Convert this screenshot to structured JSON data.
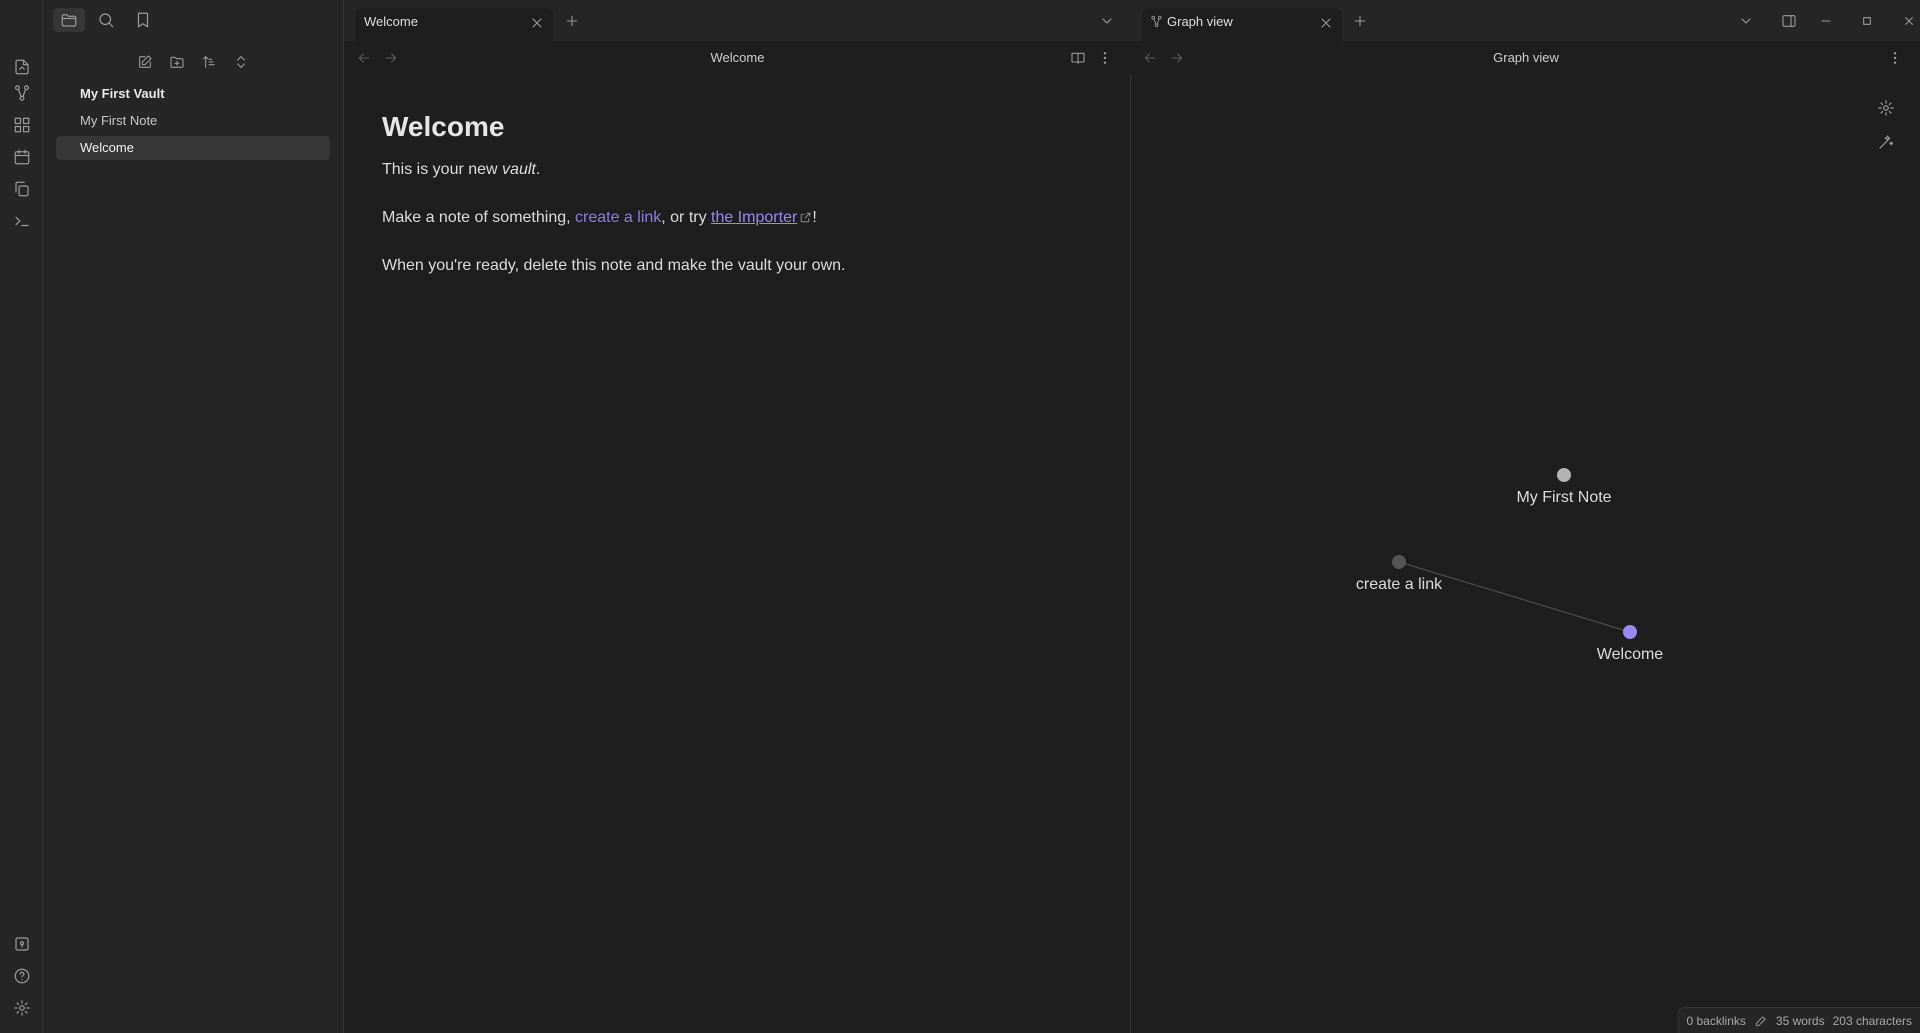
{
  "colors": {
    "accent": "#8f7be0",
    "node_active": "#9b87f5",
    "node_default": "#b3b3b3",
    "node_unresolved": "#555555",
    "edge": "#4a4a4a"
  },
  "ribbon": {
    "top_icons": [
      "open-quick-switcher-icon",
      "graph-view-icon",
      "canvas-icon",
      "daily-note-icon",
      "templates-icon",
      "command-palette-icon"
    ],
    "bottom_icons": [
      "vault-switch-icon",
      "help-icon",
      "settings-icon"
    ]
  },
  "sidebar": {
    "tabs": [
      "files-icon",
      "search-icon",
      "bookmarks-icon"
    ],
    "nav_actions": [
      "new-note-icon",
      "new-folder-icon",
      "sort-icon",
      "collapse-all-icon"
    ],
    "vault_name": "My First Vault",
    "files": [
      "My First Note",
      "Welcome"
    ],
    "active_file": "Welcome"
  },
  "left_tabs": {
    "title": "Welcome"
  },
  "right_tabs": {
    "title": "Graph view"
  },
  "editor": {
    "view_title": "Welcome",
    "heading": "Welcome",
    "p1_before": "This is your new ",
    "p1_em": "vault",
    "p1_after": ".",
    "p2_before": "Make a note of something, ",
    "p2_link": "create a link",
    "p2_middle": ", or try ",
    "p2_ext_link": "the Importer",
    "p2_after": "!",
    "p3": "When you're ready, delete this note and make the vault your own."
  },
  "graph": {
    "view_title": "Graph view",
    "nodes": [
      {
        "label": "My First Note",
        "state": "default"
      },
      {
        "label": "create a link",
        "state": "unresolved"
      },
      {
        "label": "Welcome",
        "state": "active"
      }
    ],
    "edges": [
      [
        "create a link",
        "Welcome"
      ]
    ]
  },
  "status": {
    "backlinks": "0 backlinks",
    "words": "35 words",
    "characters": "203 characters"
  }
}
